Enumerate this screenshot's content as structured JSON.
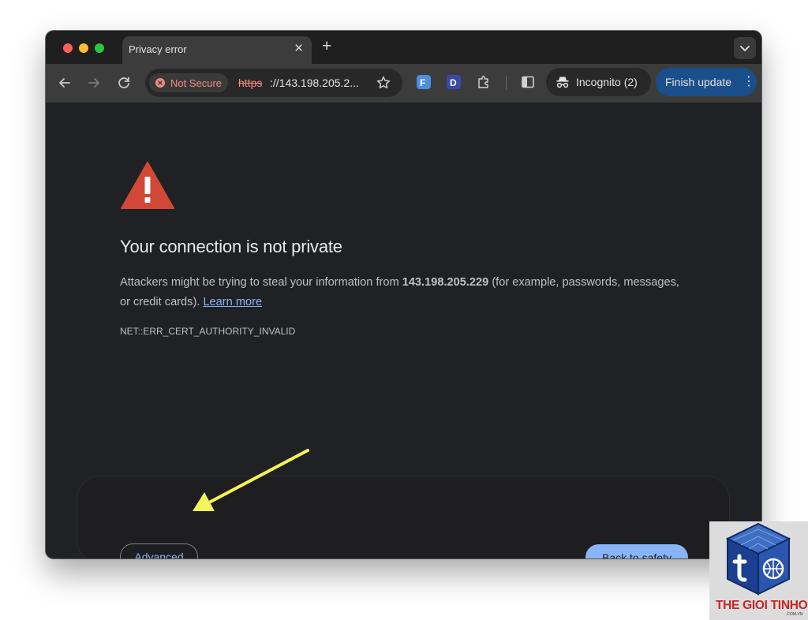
{
  "browser": {
    "tab": {
      "title": "Privacy error",
      "close_glyph": "✕"
    },
    "new_tab_glyph": "+",
    "toolbar": {
      "security_chip_label": "Not Secure",
      "url_scheme": "https",
      "url_rest": "://143.198.205.2...",
      "incognito_label": "Incognito (2)",
      "finish_update_label": "Finish update",
      "menu_glyph": "⋮",
      "extensions": [
        "F",
        "D"
      ]
    }
  },
  "page": {
    "heading": "Your connection is not private",
    "desc_before": "Attackers might be trying to steal your information from ",
    "desc_host": "143.198.205.229",
    "desc_after": " (for example, passwords, messages, or credit cards). ",
    "learn_more": "Learn more",
    "error_code": "NET::ERR_CERT_AUTHORITY_INVALID",
    "advanced_button": "Advanced",
    "back_button": "Back to safety"
  },
  "watermark": {
    "text": "THE GIOI TINHOC",
    "sub": ".COM.VN"
  },
  "colors": {
    "page_bg": "#202124",
    "link": "#8ab4f8",
    "warning_red": "#d14836",
    "not_secure": "#f28b82",
    "annotation_arrow": "#f4f45a"
  },
  "icons": {
    "back": "arrow-left-icon",
    "forward": "arrow-right-icon",
    "reload": "reload-icon",
    "bookmark": "star-icon",
    "extensions": "puzzle-icon",
    "side_panel": "side-panel-icon",
    "incognito": "incognito-icon",
    "warning": "warning-triangle-icon"
  }
}
